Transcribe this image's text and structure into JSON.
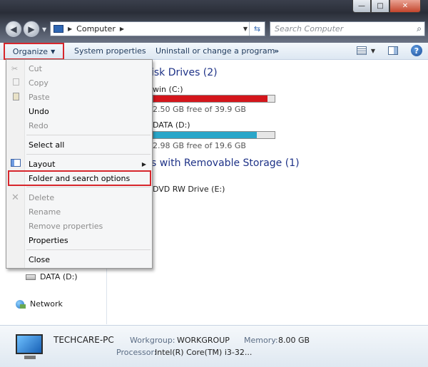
{
  "window": {
    "min_glyph": "—",
    "max_glyph": "□",
    "close_glyph": "✕"
  },
  "address": {
    "crumbs": [
      "Computer"
    ],
    "search_placeholder": "Search Computer"
  },
  "toolbar": {
    "organize": "Organize",
    "system_properties": "System properties",
    "uninstall": "Uninstall or change a program",
    "more": "»"
  },
  "nav": {
    "drive": "DATA (D:)",
    "network": "Network"
  },
  "content": {
    "group1": "isk Drives (2)",
    "drives": [
      {
        "name": "win (C:)",
        "free": "2.50 GB free of 39.9 GB",
        "used_fraction": 0.94,
        "color": "#d4161c"
      },
      {
        "name": "DATA (D:)",
        "free": "2.98 GB free of 19.6 GB",
        "used_fraction": 0.85,
        "color": "#2aa6c9"
      }
    ],
    "group2": "s with Removable Storage (1)",
    "removable": "DVD RW Drive (E:)"
  },
  "menu": {
    "cut": "Cut",
    "copy": "Copy",
    "paste": "Paste",
    "undo": "Undo",
    "redo": "Redo",
    "select_all": "Select all",
    "layout": "Layout",
    "folder_options": "Folder and search options",
    "delete": "Delete",
    "rename": "Rename",
    "remove_properties": "Remove properties",
    "properties": "Properties",
    "close": "Close"
  },
  "details": {
    "pc_name": "TECHCARE-PC",
    "workgroup_label": "Workgroup:",
    "workgroup": "WORKGROUP",
    "memory_label": "Memory:",
    "memory": "8.00 GB",
    "processor_label": "Processor:",
    "processor": "Intel(R) Core(TM) i3-32..."
  }
}
